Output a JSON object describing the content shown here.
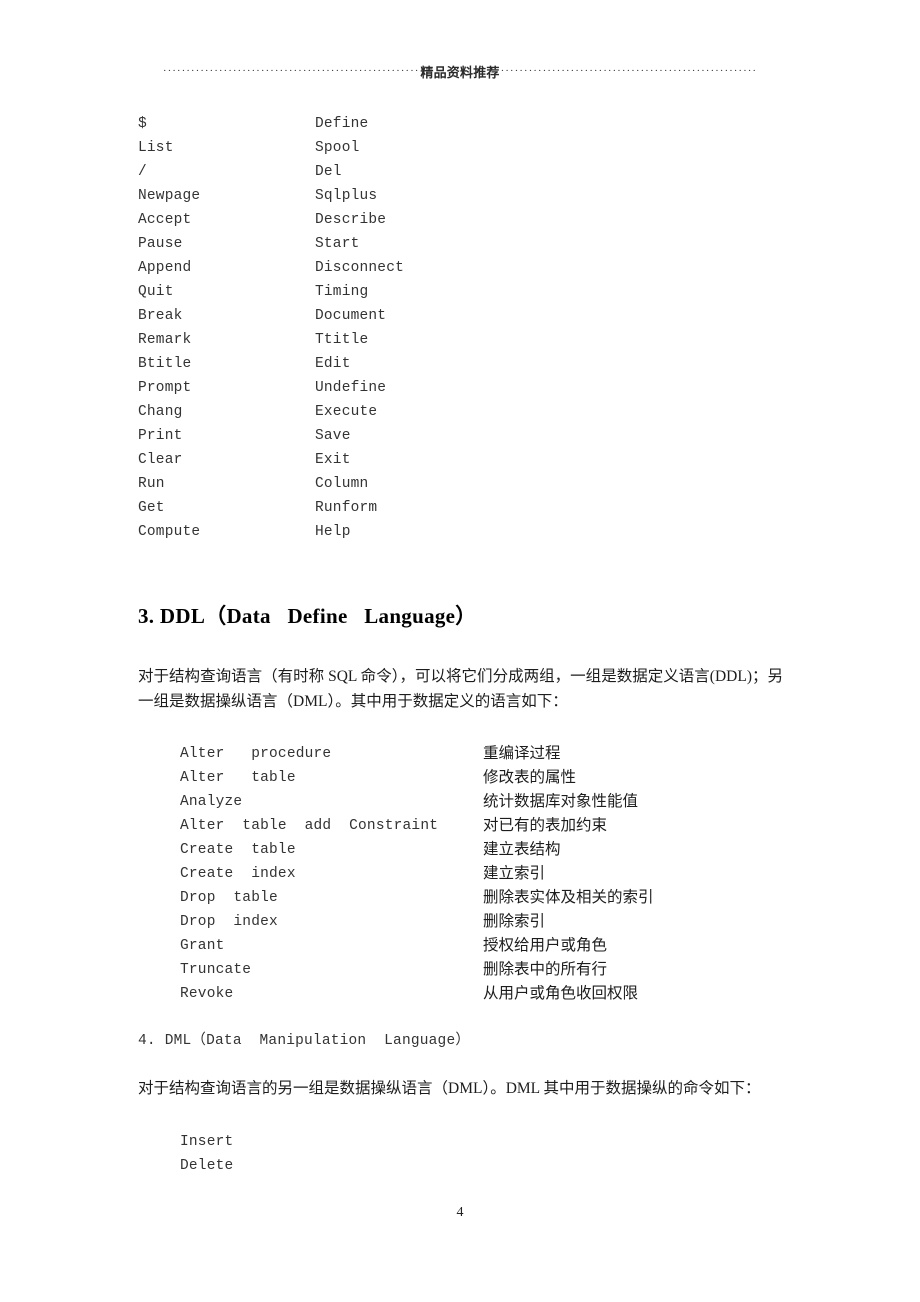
{
  "header": {
    "title": "精品资料推荐",
    "dots_left": "·······················································",
    "dots_right": "·······················································"
  },
  "sqlplus_commands": {
    "rows": [
      {
        "left": "$",
        "right": "Define"
      },
      {
        "left": "List",
        "right": "Spool"
      },
      {
        "left": "/",
        "right": "Del"
      },
      {
        "left": "Newpage",
        "right": "Sqlplus"
      },
      {
        "left": "Accept",
        "right": "Describe"
      },
      {
        "left": "Pause",
        "right": "Start"
      },
      {
        "left": "Append",
        "right": "Disconnect"
      },
      {
        "left": "Quit",
        "right": "Timing"
      },
      {
        "left": "Break",
        "right": "Document"
      },
      {
        "left": "Remark",
        "right": "Ttitle"
      },
      {
        "left": "Btitle",
        "right": "Edit"
      },
      {
        "left": "Prompt",
        "right": "Undefine"
      },
      {
        "left": "Chang",
        "right": "Execute"
      },
      {
        "left": "Print",
        "right": "Save"
      },
      {
        "left": "Clear",
        "right": "Exit"
      },
      {
        "left": "Run",
        "right": "Column"
      },
      {
        "left": "Get",
        "right": "Runform"
      },
      {
        "left": "Compute",
        "right": "Help"
      }
    ]
  },
  "ddl_section": {
    "heading": "3. DDL（Data   Define   Language）",
    "paragraph": "对于结构查询语言（有时称 SQL 命令），可以将它们分成两组，一组是数据定义语言(DDL)；另一组是数据操纵语言（DML）。其中用于数据定义的语言如下：",
    "rows": [
      {
        "command": "Alter   procedure",
        "description": "重编译过程"
      },
      {
        "command": "Alter   table",
        "description": "修改表的属性"
      },
      {
        "command": "Analyze",
        "description": "统计数据库对象性能值"
      },
      {
        "command": "Alter  table  add  Constraint",
        "description": "对已有的表加约束"
      },
      {
        "command": "Create  table",
        "description": "建立表结构"
      },
      {
        "command": "Create  index",
        "description": "建立索引"
      },
      {
        "command": "Drop  table",
        "description": "删除表实体及相关的索引"
      },
      {
        "command": "Drop  index",
        "description": "删除索引"
      },
      {
        "command": "Grant",
        "description": "授权给用户或角色"
      },
      {
        "command": "Truncate",
        "description": "删除表中的所有行"
      },
      {
        "command": "Revoke",
        "description": "从用户或角色收回权限"
      }
    ]
  },
  "dml_section": {
    "heading": "4. DML（Data  Manipulation  Language）",
    "paragraph": "对于结构查询语言的另一组是数据操纵语言（DML）。DML 其中用于数据操纵的命令如下：",
    "rows": [
      {
        "command": "Insert"
      },
      {
        "command": "Delete"
      }
    ]
  },
  "footer": {
    "page_number": "4"
  }
}
